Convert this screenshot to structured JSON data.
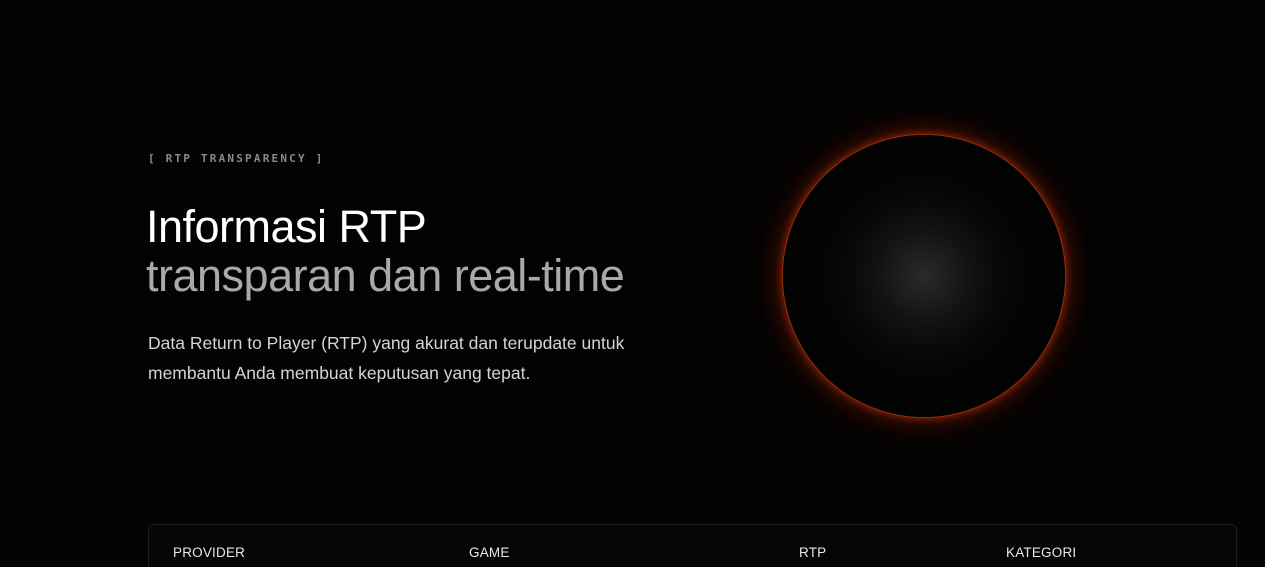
{
  "hero": {
    "eyebrow": "[ RTP TRANSPARENCY ]",
    "title_line1": "Informasi RTP",
    "title_line2": "transparan dan real-time",
    "description": "Data Return to Player (RTP) yang akurat dan terupdate untuk membantu Anda membuat keputusan yang tepat."
  },
  "table": {
    "headers": [
      "PROVIDER",
      "GAME",
      "RTP",
      "KATEGORI"
    ]
  },
  "colors": {
    "background": "#030303",
    "orb_rim": "#c83c14",
    "muted_text": "#a9a9a9"
  }
}
